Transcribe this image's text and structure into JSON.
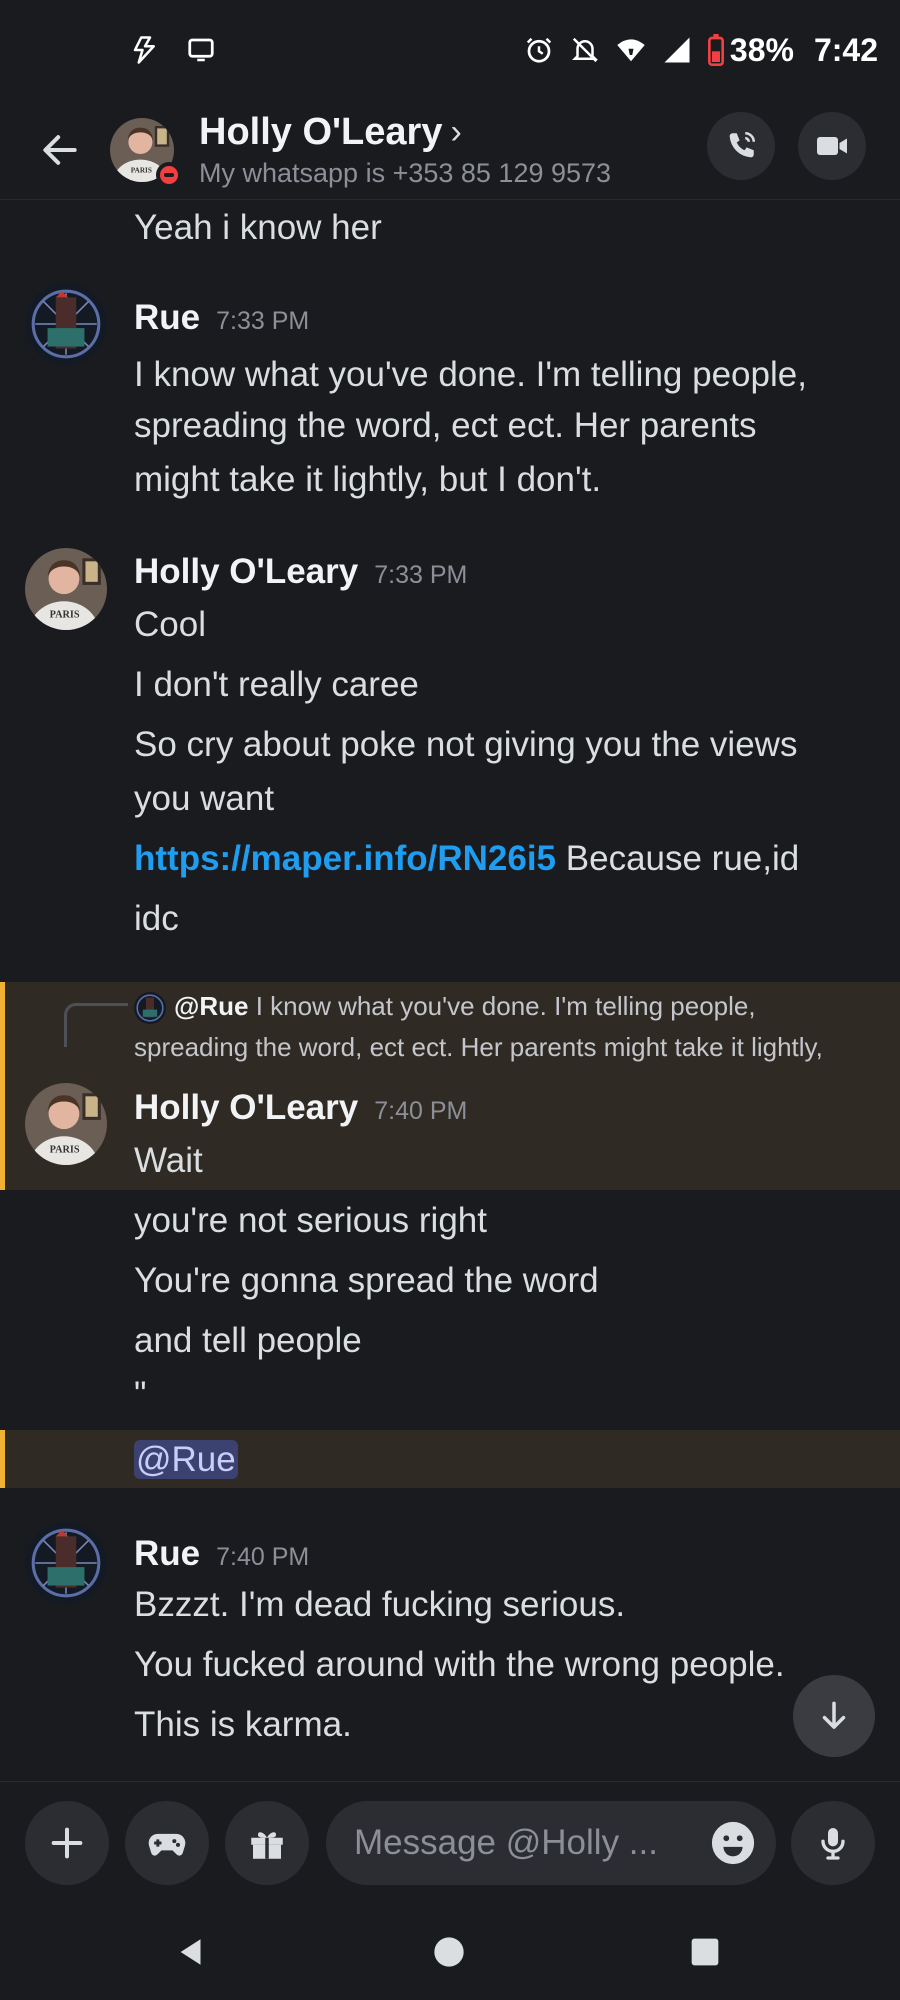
{
  "status_bar": {
    "battery": "38%",
    "time": "7:42"
  },
  "header": {
    "name": "Holly O'Leary",
    "chevron": "›",
    "status": "My whatsapp is +353 85 129 9573"
  },
  "messages": {
    "prev_line": "Yeah i know her",
    "rue1": {
      "author": "Rue",
      "time": "7:33 PM",
      "lines": [
        "I know what you've done. I'm telling people,",
        "spreading the word, ect ect. Her parents",
        "might take it lightly, but I don't."
      ]
    },
    "holly1": {
      "author": "Holly O'Leary",
      "time": "7:33 PM",
      "lines": [
        "Cool",
        "I don't really caree",
        "So cry about poke not giving you the views",
        "you want"
      ],
      "link": "https://maper.info/RN26i5",
      "link_tail": " Because rue,id",
      "last": "idc"
    },
    "reply": {
      "mention": "@Rue",
      "text1": " I know what you've done. I'm telling people,",
      "text2": "spreading the word, ect ect. Her parents might take it lightly,"
    },
    "holly2": {
      "author": "Holly O'Leary",
      "time": "7:40 PM",
      "lines": [
        "Wait",
        "you're not serious right",
        "You're gonna spread the word",
        "and tell people",
        "\""
      ],
      "mention": "@Rue"
    },
    "rue2": {
      "author": "Rue",
      "time": "7:40 PM",
      "lines": [
        "Bzzzt. I'm dead fucking serious.",
        "You fucked around with the wrong people.",
        "This is karma."
      ]
    }
  },
  "composer": {
    "placeholder": "Message @Holly ..."
  },
  "colors": {
    "background": "#1a1b1f",
    "link": "#1f9df0",
    "highlight_bar": "#f0b232",
    "dnd": "#f23f42"
  }
}
